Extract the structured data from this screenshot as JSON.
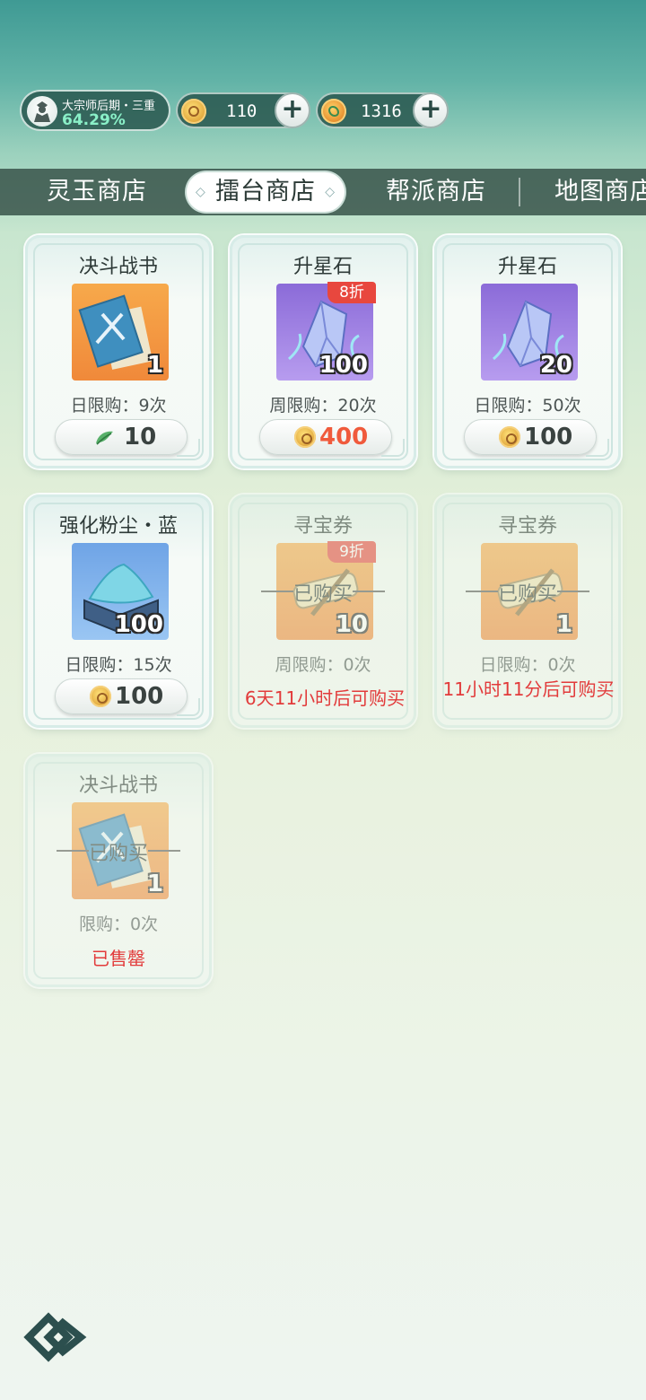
{
  "header": {
    "player": {
      "rank": "大宗师后期・三重",
      "progress": "64.29%"
    },
    "currencies": [
      {
        "name": "arena-coin-icon",
        "value": "110"
      },
      {
        "name": "jade-coin-icon",
        "value": "1316"
      }
    ]
  },
  "tabs": [
    {
      "label": "灵玉商店",
      "active": false
    },
    {
      "label": "擂台商店",
      "active": true
    },
    {
      "label": "帮派商店",
      "active": false
    },
    {
      "label": "地图商店",
      "active": false
    }
  ],
  "items": [
    {
      "title": "决斗战书",
      "qty": "1",
      "limit": "日限购：9次",
      "price": "10",
      "currency": "jade-leaf-icon"
    },
    {
      "title": "升星石",
      "qty": "100",
      "badge": "8折",
      "limit": "周限购：20次",
      "price": "400",
      "currency": "arena-coin-icon"
    },
    {
      "title": "升星石",
      "qty": "20",
      "limit": "日限购：50次",
      "price": "100",
      "currency": "arena-coin-icon"
    },
    {
      "title": "强化粉尘・蓝",
      "qty": "100",
      "limit": "日限购：15次",
      "price": "100",
      "currency": "arena-coin-icon"
    },
    {
      "title": "寻宝券",
      "qty": "10",
      "badge": "9折",
      "bought": "已购买",
      "limit": "周限购：0次",
      "status": "6天11小时后可购买"
    },
    {
      "title": "寻宝券",
      "qty": "1",
      "bought": "已购买",
      "limit": "日限购：0次",
      "status": "11小时11分后可购买"
    },
    {
      "title": "决斗战书",
      "qty": "1",
      "bought": "已购买",
      "limit": "限购：0次",
      "status": "已售罄"
    }
  ],
  "colors": {
    "accent_red": "#e23b3b",
    "discount_badge": "#e8473e",
    "tab_bar": "#38544a"
  }
}
